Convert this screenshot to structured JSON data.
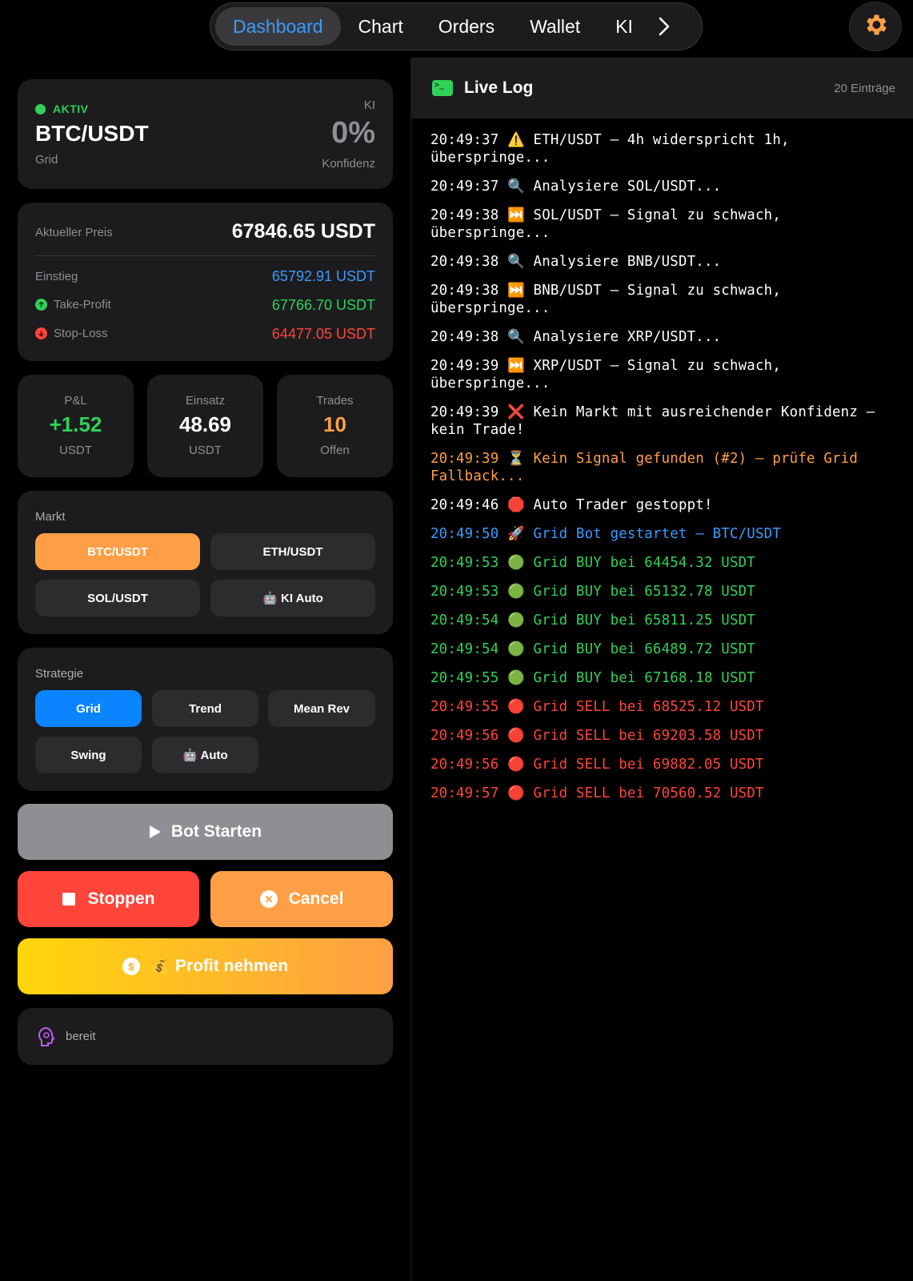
{
  "nav": {
    "tabs": [
      "Dashboard",
      "Chart",
      "Orders",
      "Wallet",
      "KI"
    ],
    "active": "Dashboard",
    "more_icon": "chevron-right-icon",
    "settings_icon": "gear-icon"
  },
  "status": {
    "state": "AKTIV",
    "pair": "BTC/USDT",
    "strategy": "Grid",
    "ki_label": "KI",
    "confidence": "0%",
    "confidence_label": "Konfidenz"
  },
  "prices": {
    "current_label": "Aktueller Preis",
    "current_value": "67846.65 USDT",
    "entry_label": "Einstieg",
    "entry_value": "65792.91 USDT",
    "tp_label": "Take-Profit",
    "tp_value": "67766.70 USDT",
    "sl_label": "Stop-Loss",
    "sl_value": "64477.05 USDT"
  },
  "stats": [
    {
      "label": "P&L",
      "value": "+1.52",
      "unit": "USDT"
    },
    {
      "label": "Einsatz",
      "value": "48.69",
      "unit": "USDT"
    },
    {
      "label": "Trades",
      "value": "10",
      "unit": "Offen"
    }
  ],
  "market": {
    "title": "Markt",
    "options": [
      "BTC/USDT",
      "ETH/USDT",
      "SOL/USDT",
      "🤖 KI Auto"
    ],
    "selected": "BTC/USDT"
  },
  "strategy": {
    "title": "Strategie",
    "options": [
      "Grid",
      "Trend",
      "Mean Rev",
      "Swing",
      "🤖 Auto"
    ],
    "selected": "Grid"
  },
  "actions": {
    "start": "Bot Starten",
    "stop": "Stoppen",
    "cancel": "Cancel",
    "profit": "💰 Profit nehmen"
  },
  "bot_status": {
    "icon": "brain-icon",
    "text": "bereit"
  },
  "log": {
    "title": "Live Log",
    "count": "20 Einträge",
    "entries": [
      {
        "text": "20:49:37 ⚠️ ETH/USDT — 4h widerspricht 1h, überspringe...",
        "color": "white"
      },
      {
        "text": "20:49:37 🔍 Analysiere SOL/USDT...",
        "color": "white"
      },
      {
        "text": "20:49:38 ⏭️ SOL/USDT — Signal zu schwach, überspringe...",
        "color": "white"
      },
      {
        "text": "20:49:38 🔍 Analysiere BNB/USDT...",
        "color": "white"
      },
      {
        "text": "20:49:38 ⏭️ BNB/USDT — Signal zu schwach, überspringe...",
        "color": "white"
      },
      {
        "text": "20:49:38 🔍 Analysiere XRP/USDT...",
        "color": "white"
      },
      {
        "text": "20:49:39 ⏭️ XRP/USDT — Signal zu schwach, überspringe...",
        "color": "white"
      },
      {
        "text": "20:49:39 ❌ Kein Markt mit ausreichender Konfidenz — kein Trade!",
        "color": "white"
      },
      {
        "text": "20:49:39 ⏳ Kein Signal gefunden (#2) — prüfe Grid Fallback...",
        "color": "orange"
      },
      {
        "text": "20:49:46 🛑 Auto Trader gestoppt!",
        "color": "white"
      },
      {
        "text": "20:49:50 🚀 Grid Bot gestartet — BTC/USDT",
        "color": "blue"
      },
      {
        "text": "20:49:53 🟢 Grid BUY bei 64454.32 USDT",
        "color": "green"
      },
      {
        "text": "20:49:53 🟢 Grid BUY bei 65132.78 USDT",
        "color": "green"
      },
      {
        "text": "20:49:54 🟢 Grid BUY bei 65811.25 USDT",
        "color": "green"
      },
      {
        "text": "20:49:54 🟢 Grid BUY bei 66489.72 USDT",
        "color": "green"
      },
      {
        "text": "20:49:55 🟢 Grid BUY bei 67168.18 USDT",
        "color": "green"
      },
      {
        "text": "20:49:55 🔴 Grid SELL bei 68525.12 USDT",
        "color": "red"
      },
      {
        "text": "20:49:56 🔴 Grid SELL bei 69203.58 USDT",
        "color": "red"
      },
      {
        "text": "20:49:56 🔴 Grid SELL bei 69882.05 USDT",
        "color": "red"
      },
      {
        "text": "20:49:57 🔴 Grid SELL bei 70560.52 USDT",
        "color": "red"
      }
    ]
  },
  "colors": {
    "accent_blue": "#0a84ff",
    "orange": "#ff9f45",
    "green": "#30d158",
    "red": "#ff453a",
    "card": "#1c1c1e"
  }
}
